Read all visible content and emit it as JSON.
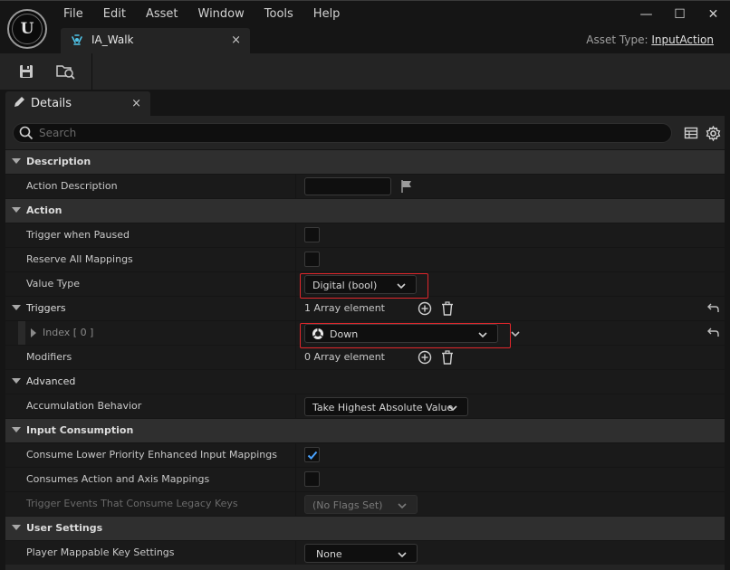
{
  "menu": [
    "File",
    "Edit",
    "Asset",
    "Window",
    "Tools",
    "Help"
  ],
  "window_controls": {
    "minimize": "—",
    "maximize": "☐",
    "close": "✕"
  },
  "asset_tab": {
    "label": "IA_Walk",
    "close": "×"
  },
  "asset_type": {
    "label": "Asset Type:",
    "value": "InputAction"
  },
  "toolbar": {
    "save_icon": "save-icon",
    "browse_icon": "browse-to-asset-icon"
  },
  "details_tab": {
    "label": "Details",
    "close": "×"
  },
  "search": {
    "placeholder": "Search",
    "value": ""
  },
  "categories": {
    "description": "Description",
    "action": "Action",
    "triggers": "Triggers",
    "advanced": "Advanced",
    "input_consumption": "Input Consumption",
    "user_settings": "User Settings"
  },
  "properties": {
    "action_description": {
      "label": "Action Description",
      "value": ""
    },
    "trigger_when_paused": {
      "label": "Trigger when Paused",
      "checked": false
    },
    "reserve_all_mappings": {
      "label": "Reserve All Mappings",
      "checked": false
    },
    "value_type": {
      "label": "Value Type",
      "value": "Digital (bool)"
    },
    "triggers": {
      "count_text": "1 Array element"
    },
    "trigger_index": {
      "label": "Index [ 0 ]",
      "value": "Down"
    },
    "modifiers": {
      "label": "Modifiers",
      "count_text": "0 Array element"
    },
    "accumulation_behavior": {
      "label": "Accumulation Behavior",
      "value": "Take Highest Absolute Value"
    },
    "consume_lower_priority": {
      "label": "Consume Lower Priority Enhanced Input Mappings",
      "checked": true
    },
    "consumes_action_axis": {
      "label": "Consumes Action and Axis Mappings",
      "checked": false
    },
    "trigger_events_legacy": {
      "label": "Trigger Events That Consume Legacy Keys",
      "value": "(No Flags Set)"
    },
    "player_mappable_key_settings": {
      "label": "Player Mappable Key Settings",
      "value": "None"
    }
  },
  "colors": {
    "accent": "#4fc3e8",
    "highlight_box": "#e0262b",
    "check": "#4aa3ff"
  }
}
